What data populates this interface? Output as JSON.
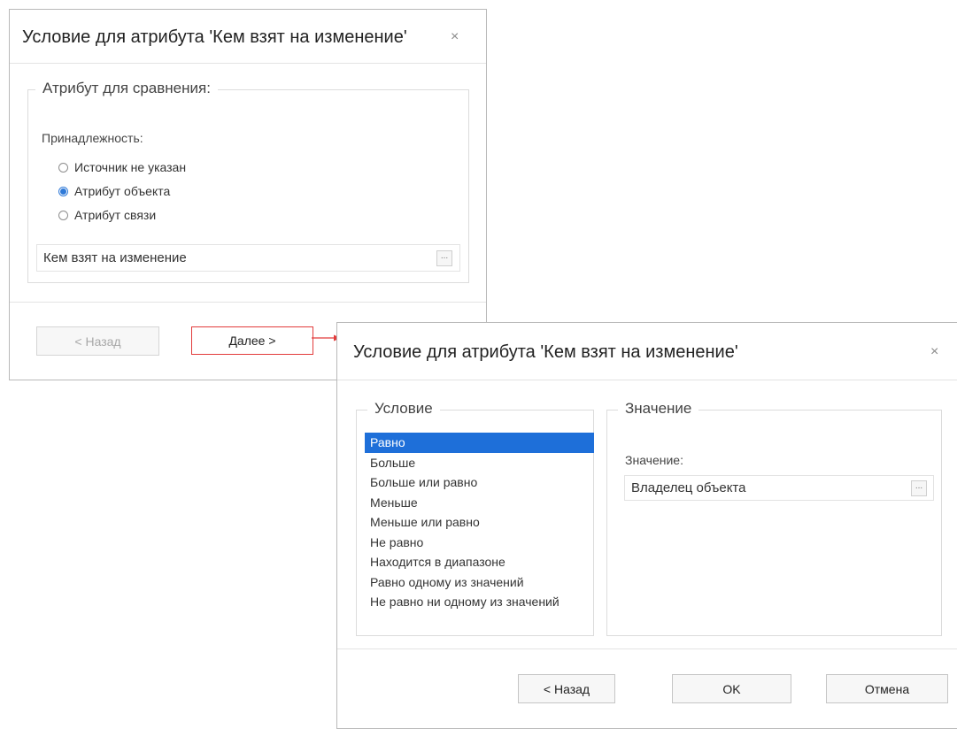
{
  "dialog1": {
    "title": "Условие для атрибута 'Кем взят на изменение'",
    "close_glyph": "×",
    "group_legend": "Атрибут для сравнения:",
    "ownership_label": "Принадлежность:",
    "radio_options": [
      {
        "label": "Источник не указан",
        "checked": false
      },
      {
        "label": "Атрибут объекта",
        "checked": true
      },
      {
        "label": "Атрибут связи",
        "checked": false
      }
    ],
    "attribute_value": "Кем взят на изменение",
    "browse_glyph": "...",
    "back_label": "< Назад",
    "next_label": "Далее >"
  },
  "dialog2": {
    "title": "Условие для атрибута 'Кем взят на изменение'",
    "close_glyph": "×",
    "condition_legend": "Условие",
    "conditions": [
      "Равно",
      "Больше",
      "Больше или равно",
      "Меньше",
      "Меньше или равно",
      "Не равно",
      "Находится в диапазоне",
      "Равно одному из значений",
      "Не равно ни одному из значений"
    ],
    "selected_condition": "Равно",
    "value_legend": "Значение",
    "value_label": "Значение:",
    "value": "Владелец объекта",
    "browse_glyph": "...",
    "back_label": "< Назад",
    "ok_label": "OK",
    "cancel_label": "Отмена"
  },
  "colors": {
    "highlight_border": "#e23b3b",
    "selection": "#1e6fd9",
    "radio_accent": "#2f7ad8"
  }
}
